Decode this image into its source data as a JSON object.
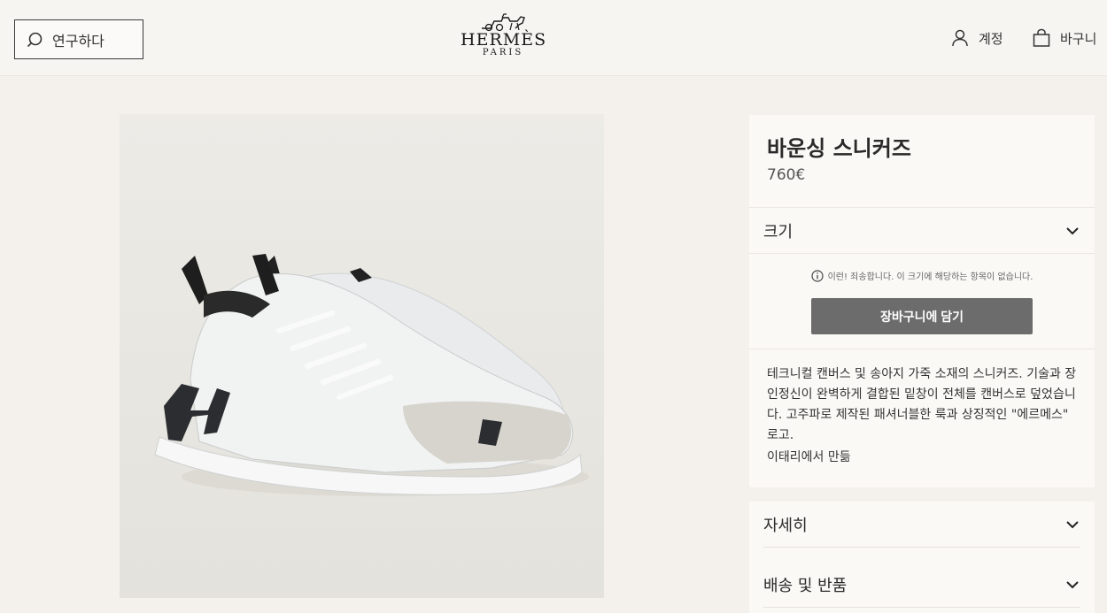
{
  "header": {
    "search_placeholder": "연구하다",
    "logo_brand": "HERMÈS",
    "logo_city": "PARIS",
    "account_label": "계정",
    "cart_label": "바구니"
  },
  "product": {
    "title": "바운싱 스니커즈",
    "price": "760€",
    "size_label": "크기",
    "size_notice": "이런! 죄송합니다. 이 크기에 해당하는 항목이 없습니다.",
    "add_to_cart": "장바구니에 담기",
    "description": "테크니컬 캔버스 및 송아지 가죽 소재의 스니커즈. 기술과 장인정신이 완벽하게 결합된 밑창이 전체를 캔버스로 덮었습니다. 고주파로 제작된 패셔너블한 룩과 상징적인 \"에르메스\" 로고.",
    "made_in": "이태리에서 만듦"
  },
  "accordion": {
    "details_label": "자세히",
    "shipping_label": "배송 및 반품"
  },
  "colors": {
    "page_bg": "#f4f1ec",
    "panel_bg": "#fbf9f6",
    "button_bg": "#6c6c6c"
  },
  "icons": [
    "search-icon",
    "user-icon",
    "bag-icon",
    "info-icon",
    "chevron-down-icon"
  ]
}
